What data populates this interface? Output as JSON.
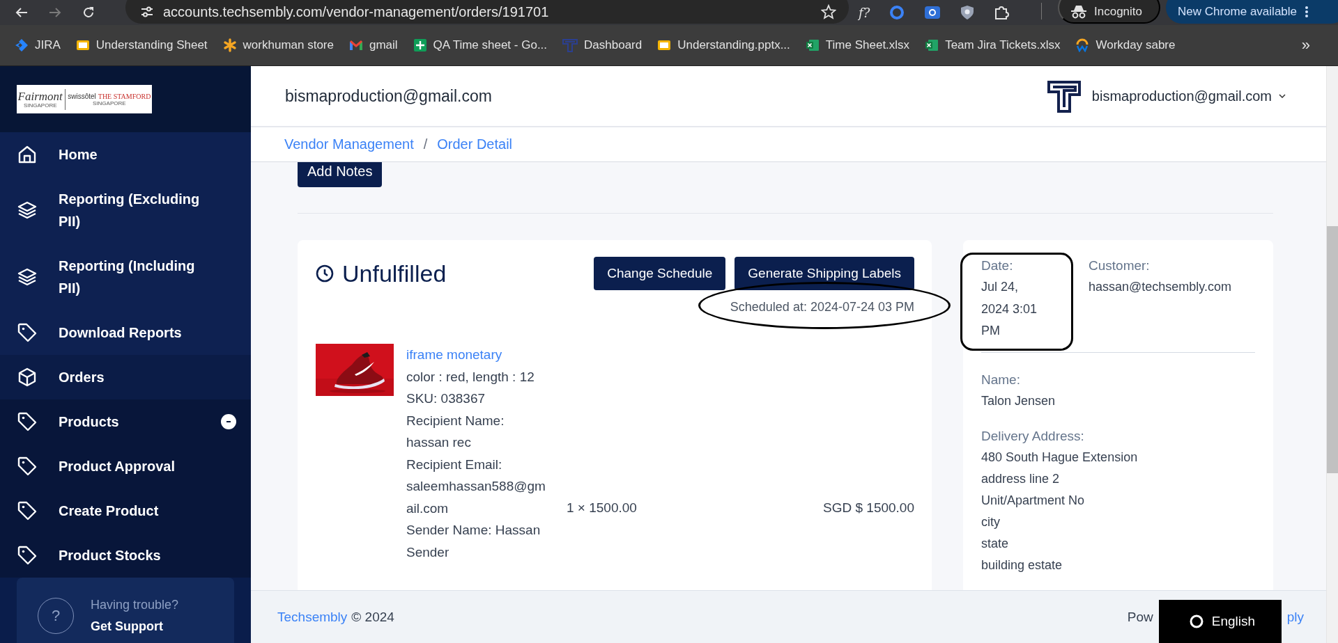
{
  "browser": {
    "url": "accounts.techsembly.com/vendor-management/orders/191701",
    "forward_disabled": true,
    "extension_text": "f?",
    "incognito_label": "Incognito",
    "update_button": "New Chrome available"
  },
  "bookmarks": [
    {
      "label": "JIRA",
      "kind": "jira"
    },
    {
      "label": "Understanding Sheet",
      "kind": "slides"
    },
    {
      "label": "workhuman store",
      "kind": "asterisk"
    },
    {
      "label": "gmail",
      "kind": "mail"
    },
    {
      "label": "QA Time sheet - Go...",
      "kind": "sheets"
    },
    {
      "label": "Dashboard",
      "kind": "logo"
    },
    {
      "label": "Understanding.pptx...",
      "kind": "slides"
    },
    {
      "label": "Time Sheet.xlsx",
      "kind": "excel"
    },
    {
      "label": "Team Jira Tickets.xlsx",
      "kind": "excel"
    },
    {
      "label": "Workday sabre",
      "kind": "workday"
    }
  ],
  "bookmarks_more": "»",
  "sidebar": {
    "logo": {
      "left": "Fairmont",
      "left_sub": "SINGAPORE",
      "right": "swissôtel",
      "right_name": "THE STAMFORD",
      "right_sub": "SINGAPORE"
    },
    "groups": [
      {
        "items": [
          {
            "label": "Home",
            "kind": "home"
          },
          {
            "label": "Reporting (Excluding PII)",
            "kind": "layers"
          },
          {
            "label": "Reporting (Including PII)",
            "kind": "layers"
          },
          {
            "label": "Download Reports",
            "kind": "tag"
          }
        ]
      },
      {
        "items": [
          {
            "label": "Orders",
            "kind": "cube"
          }
        ]
      },
      {
        "items": [
          {
            "label": "Products",
            "kind": "tag",
            "expanded": true,
            "children": [
              {
                "label": "Product Approval",
                "kind": "tag"
              },
              {
                "label": "Create Product",
                "kind": "tag"
              },
              {
                "label": "Product Stocks",
                "kind": "tag"
              }
            ]
          }
        ]
      }
    ],
    "support": {
      "icon_text": "?",
      "question": "Having trouble?",
      "link": "Get Support"
    }
  },
  "header": {
    "title": "bismaproduction@gmail.com",
    "user": "bismaproduction@gmail.com"
  },
  "breadcrumb": {
    "items": [
      "Vendor Management",
      "Order Detail"
    ],
    "separator": "/"
  },
  "order": {
    "add_notes_button": "Add Notes",
    "status": "Unfulfilled",
    "buttons": [
      "Change Schedule",
      "Generate Shipping Labels"
    ],
    "scheduled": {
      "text": "Scheduled at: 2024-07-24 03 PM",
      "circled": true
    },
    "line_items": [
      {
        "image": {
          "kind": "picture"
        },
        "name": "iframe monetary",
        "details": [
          "color : red, length : 12",
          "SKU: 038367",
          "Recipient Name: hassan rec",
          "Recipient Email: saleemhassan588@gmail.com",
          "Sender Name: Hassan Sender"
        ],
        "quantity": "1 × 1500.00",
        "total": "SGD $ 1500.00"
      }
    ]
  },
  "customer_card": {
    "date": {
      "label": "Date:",
      "value": "Jul 24, 2024 3:01 PM",
      "circled": true
    },
    "customer": {
      "label": "Customer:",
      "value": "hassan@techsembly.com"
    },
    "name": {
      "label": "Name:",
      "value": "Talon Jensen"
    },
    "address": {
      "label": "Delivery Address:",
      "lines": [
        "480 South Hague Extension",
        "address line 2",
        "Unit/Apartment No",
        "city",
        "state",
        "building estate"
      ]
    }
  },
  "footer": {
    "brand": "Techsembly",
    "copyright": "© 2024",
    "powered_start": "Pow",
    "powered_end": "ply",
    "language_button": "English"
  }
}
